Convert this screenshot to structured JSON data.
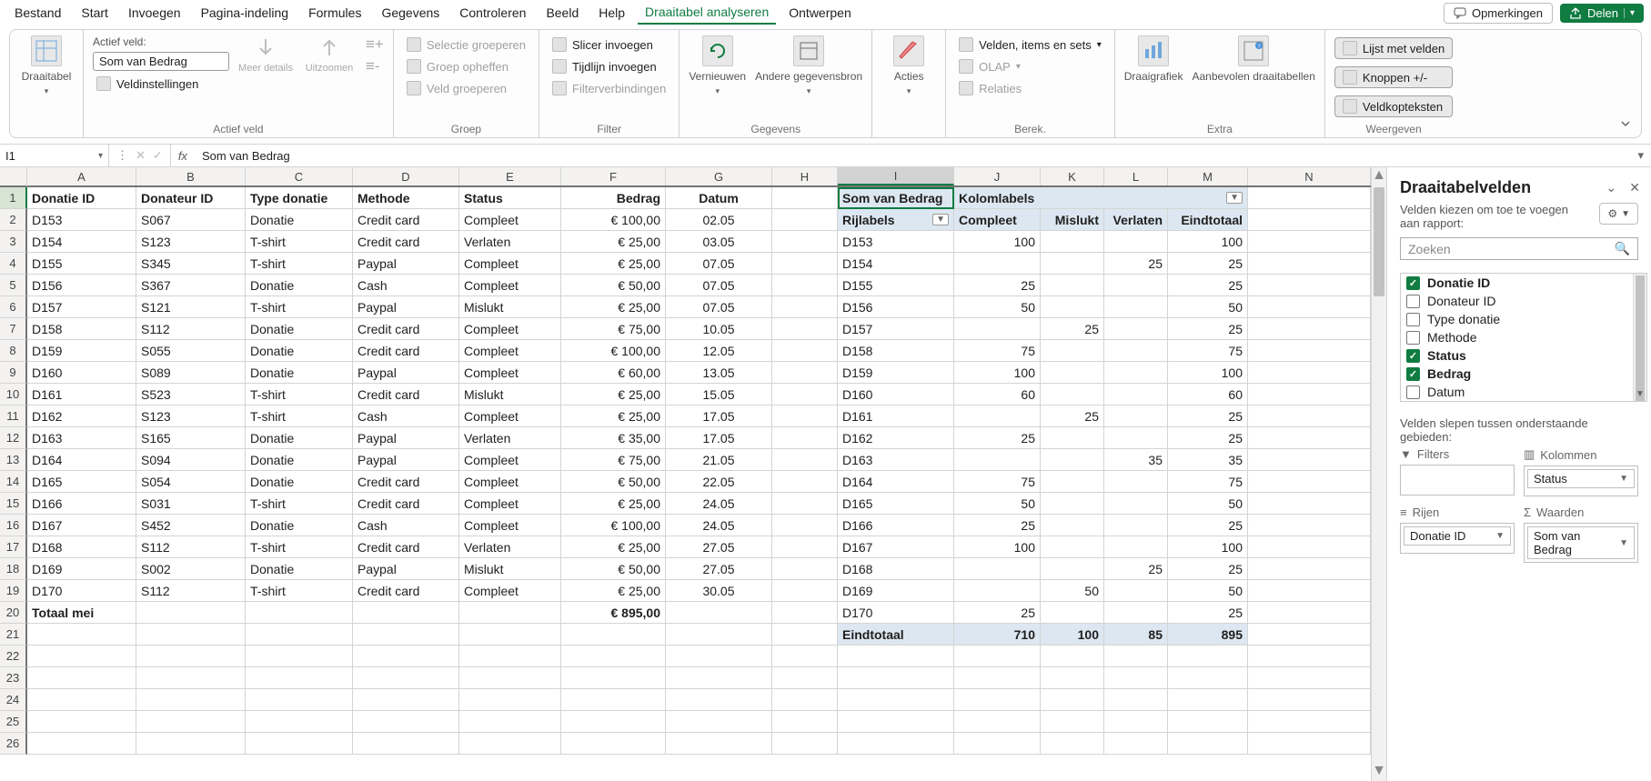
{
  "menu": {
    "tabs": [
      "Bestand",
      "Start",
      "Invoegen",
      "Pagina-indeling",
      "Formules",
      "Gegevens",
      "Controleren",
      "Beeld",
      "Help",
      "Draaitabel analyseren",
      "Ontwerpen"
    ],
    "active_index": 9,
    "comments_label": "Opmerkingen",
    "share_label": "Delen"
  },
  "ribbon": {
    "pivot": {
      "big": "Draaitabel"
    },
    "active_field": {
      "label": "Actief veld:",
      "value": "Som van Bedrag",
      "settings": "Veldinstellingen",
      "more_detail": "Meer details",
      "zoom_out": "Uitzoomen",
      "group_label": "Actief veld"
    },
    "group": {
      "sel": "Selectie groeperen",
      "ungroup": "Groep opheffen",
      "fieldgroup": "Veld groeperen",
      "label": "Groep"
    },
    "filter": {
      "slicer": "Slicer invoegen",
      "timeline": "Tijdlijn invoegen",
      "conn": "Filterverbindingen",
      "label": "Filter"
    },
    "data": {
      "refresh": "Vernieuwen",
      "source": "Andere gegevensbron",
      "label": "Gegevens"
    },
    "actions": {
      "big": "Acties",
      "label": ""
    },
    "calc": {
      "fields": "Velden, items en sets",
      "olap": "OLAP",
      "rel": "Relaties",
      "label": "Berek."
    },
    "extra": {
      "chart": "Draaigrafiek",
      "recommended": "Aanbevolen draaitabellen",
      "label": "Extra"
    },
    "show": {
      "fieldlist": "Lijst met velden",
      "buttons": "Knoppen +/-",
      "headers": "Veldkopteksten",
      "label": "Weergeven"
    }
  },
  "formula_bar": {
    "name_box": "I1",
    "value": "Som van Bedrag"
  },
  "colHeaders": [
    "A",
    "B",
    "C",
    "D",
    "E",
    "F",
    "G",
    "H",
    "I",
    "J",
    "K",
    "L",
    "M",
    "N"
  ],
  "rowCount": 26,
  "selected_col_index": 8,
  "selected_row": 1,
  "tableHeaders": {
    "A": "Donatie ID",
    "B": "Donateur ID",
    "C": "Type donatie",
    "D": "Methode",
    "E": "Status",
    "F": "Bedrag",
    "G": "Datum"
  },
  "tableRows": [
    {
      "A": "D153",
      "B": "S067",
      "C": "Donatie",
      "D": "Credit card",
      "E": "Compleet",
      "F": "€ 100,00",
      "G": "02.05"
    },
    {
      "A": "D154",
      "B": "S123",
      "C": "T-shirt",
      "D": "Credit card",
      "E": "Verlaten",
      "F": "€ 25,00",
      "G": "03.05"
    },
    {
      "A": "D155",
      "B": "S345",
      "C": "T-shirt",
      "D": "Paypal",
      "E": "Compleet",
      "F": "€ 25,00",
      "G": "07.05"
    },
    {
      "A": "D156",
      "B": "S367",
      "C": "Donatie",
      "D": "Cash",
      "E": "Compleet",
      "F": "€ 50,00",
      "G": "07.05"
    },
    {
      "A": "D157",
      "B": "S121",
      "C": "T-shirt",
      "D": "Paypal",
      "E": "Mislukt",
      "F": "€ 25,00",
      "G": "07.05"
    },
    {
      "A": "D158",
      "B": "S112",
      "C": "Donatie",
      "D": "Credit card",
      "E": "Compleet",
      "F": "€ 75,00",
      "G": "10.05"
    },
    {
      "A": "D159",
      "B": "S055",
      "C": "Donatie",
      "D": "Credit card",
      "E": "Compleet",
      "F": "€ 100,00",
      "G": "12.05"
    },
    {
      "A": "D160",
      "B": "S089",
      "C": "Donatie",
      "D": "Paypal",
      "E": "Compleet",
      "F": "€ 60,00",
      "G": "13.05"
    },
    {
      "A": "D161",
      "B": "S523",
      "C": "T-shirt",
      "D": "Credit card",
      "E": "Mislukt",
      "F": "€ 25,00",
      "G": "15.05"
    },
    {
      "A": "D162",
      "B": "S123",
      "C": "T-shirt",
      "D": "Cash",
      "E": "Compleet",
      "F": "€ 25,00",
      "G": "17.05"
    },
    {
      "A": "D163",
      "B": "S165",
      "C": "Donatie",
      "D": "Paypal",
      "E": "Verlaten",
      "F": "€ 35,00",
      "G": "17.05"
    },
    {
      "A": "D164",
      "B": "S094",
      "C": "Donatie",
      "D": "Paypal",
      "E": "Compleet",
      "F": "€ 75,00",
      "G": "21.05"
    },
    {
      "A": "D165",
      "B": "S054",
      "C": "Donatie",
      "D": "Credit card",
      "E": "Compleet",
      "F": "€ 50,00",
      "G": "22.05"
    },
    {
      "A": "D166",
      "B": "S031",
      "C": "T-shirt",
      "D": "Credit card",
      "E": "Compleet",
      "F": "€ 25,00",
      "G": "24.05"
    },
    {
      "A": "D167",
      "B": "S452",
      "C": "Donatie",
      "D": "Cash",
      "E": "Compleet",
      "F": "€ 100,00",
      "G": "24.05"
    },
    {
      "A": "D168",
      "B": "S112",
      "C": "T-shirt",
      "D": "Credit card",
      "E": "Verlaten",
      "F": "€ 25,00",
      "G": "27.05"
    },
    {
      "A": "D169",
      "B": "S002",
      "C": "Donatie",
      "D": "Paypal",
      "E": "Mislukt",
      "F": "€ 50,00",
      "G": "27.05"
    },
    {
      "A": "D170",
      "B": "S112",
      "C": "T-shirt",
      "D": "Credit card",
      "E": "Compleet",
      "F": "€ 25,00",
      "G": "30.05"
    }
  ],
  "totalRow": {
    "A": "Totaal mei",
    "F": "€ 895,00"
  },
  "pivot": {
    "corner": "Som van Bedrag",
    "col_label": "Kolomlabels",
    "row_label": "Rijlabels",
    "cols": [
      "Compleet",
      "Mislukt",
      "Verlaten",
      "Eindtotaal"
    ],
    "rows": [
      {
        "l": "D153",
        "v": [
          "100",
          "",
          "",
          "100"
        ]
      },
      {
        "l": "D154",
        "v": [
          "",
          "",
          "25",
          "25"
        ]
      },
      {
        "l": "D155",
        "v": [
          "25",
          "",
          "",
          "25"
        ]
      },
      {
        "l": "D156",
        "v": [
          "50",
          "",
          "",
          "50"
        ]
      },
      {
        "l": "D157",
        "v": [
          "",
          "25",
          "",
          "25"
        ]
      },
      {
        "l": "D158",
        "v": [
          "75",
          "",
          "",
          "75"
        ]
      },
      {
        "l": "D159",
        "v": [
          "100",
          "",
          "",
          "100"
        ]
      },
      {
        "l": "D160",
        "v": [
          "60",
          "",
          "",
          "60"
        ]
      },
      {
        "l": "D161",
        "v": [
          "",
          "25",
          "",
          "25"
        ]
      },
      {
        "l": "D162",
        "v": [
          "25",
          "",
          "",
          "25"
        ]
      },
      {
        "l": "D163",
        "v": [
          "",
          "",
          "35",
          "35"
        ]
      },
      {
        "l": "D164",
        "v": [
          "75",
          "",
          "",
          "75"
        ]
      },
      {
        "l": "D165",
        "v": [
          "50",
          "",
          "",
          "50"
        ]
      },
      {
        "l": "D166",
        "v": [
          "25",
          "",
          "",
          "25"
        ]
      },
      {
        "l": "D167",
        "v": [
          "100",
          "",
          "",
          "100"
        ]
      },
      {
        "l": "D168",
        "v": [
          "",
          "",
          "25",
          "25"
        ]
      },
      {
        "l": "D169",
        "v": [
          "",
          "50",
          "",
          "50"
        ]
      },
      {
        "l": "D170",
        "v": [
          "25",
          "",
          "",
          "25"
        ]
      }
    ],
    "grand": {
      "l": "Eindtotaal",
      "v": [
        "710",
        "100",
        "85",
        "895"
      ]
    }
  },
  "panel": {
    "title": "Draaitabelvelden",
    "sub1": "Velden kiezen om toe te voegen",
    "sub2": "aan rapport:",
    "search_placeholder": "Zoeken",
    "fields": [
      {
        "name": "Donatie ID",
        "on": true
      },
      {
        "name": "Donateur ID",
        "on": false
      },
      {
        "name": "Type donatie",
        "on": false
      },
      {
        "name": "Methode",
        "on": false
      },
      {
        "name": "Status",
        "on": true
      },
      {
        "name": "Bedrag",
        "on": true
      },
      {
        "name": "Datum",
        "on": false
      }
    ],
    "areas_label": "Velden slepen tussen onderstaande gebieden:",
    "areas": {
      "filters": {
        "title": "Filters",
        "chips": []
      },
      "columns": {
        "title": "Kolommen",
        "chips": [
          "Status"
        ]
      },
      "rows": {
        "title": "Rijen",
        "chips": [
          "Donatie ID"
        ]
      },
      "values": {
        "title": "Waarden",
        "chips": [
          "Som van Bedrag"
        ]
      }
    }
  }
}
